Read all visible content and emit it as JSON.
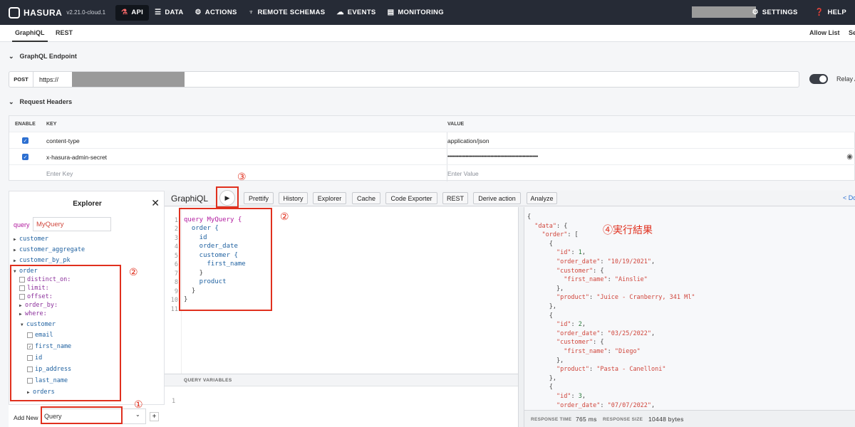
{
  "topnav": {
    "logo": "HASURA",
    "version": "v2.21.0-cloud.1",
    "items": [
      {
        "label": "API",
        "icon": "flask-icon"
      },
      {
        "label": "DATA",
        "icon": "database-icon"
      },
      {
        "label": "ACTIONS",
        "icon": "gear-icon"
      },
      {
        "label": "REMOTE SCHEMAS",
        "icon": "plug-icon"
      },
      {
        "label": "EVENTS",
        "icon": "cloud-icon"
      },
      {
        "label": "MONITORING",
        "icon": "chart-icon"
      }
    ],
    "settings": "SETTINGS",
    "help": "HELP"
  },
  "subtabs": {
    "graphiql": "GraphiQL",
    "rest": "REST",
    "allow_list": "Allow List",
    "cut": "Se"
  },
  "endpoint": {
    "section": "GraphQL Endpoint",
    "method": "POST",
    "url": "https://",
    "relay": "Relay A"
  },
  "headers": {
    "section": "Request Headers",
    "columns": [
      "ENABLE",
      "KEY",
      "VALUE"
    ],
    "rows": [
      {
        "key": "content-type",
        "value": "application/json"
      },
      {
        "key": "x-hasura-admin-secret",
        "value": "•••••••••••••••••••••••••••••••••••••••••••••••••••••••••••••••••"
      }
    ],
    "key_placeholder": "Enter Key",
    "value_placeholder": "Enter Value"
  },
  "explorer": {
    "title": "Explorer",
    "query_kw": "query",
    "query_name": "MyQuery",
    "tree": [
      "customer",
      "customer_aggregate",
      "customer_by_pk",
      "order",
      "distinct_on:",
      "limit:",
      "offset:",
      "order_by:",
      "where:",
      "customer",
      "email",
      "first_name",
      "id",
      "ip_address",
      "last_name",
      "orders"
    ],
    "add_new": "Add New",
    "add_type": "Query"
  },
  "graphiql": {
    "title": "GraphiQL",
    "buttons": [
      "Prettify",
      "History",
      "Explorer",
      "Cache",
      "Code Exporter",
      "REST",
      "Derive action",
      "Analyze"
    ],
    "docs": "< Docs",
    "code": [
      "query MyQuery {",
      "  order {",
      "    id",
      "    order_date",
      "    customer {",
      "      first_name",
      "    }",
      "    product",
      "  }",
      "}",
      ""
    ],
    "query_variables": "QUERY VARIABLES",
    "qv_line": "1"
  },
  "result": {
    "lines": [
      "{",
      "  \"data\": {",
      "    \"order\": [",
      "      {",
      "        \"id\": 1,",
      "        \"order_date\": \"10/19/2021\",",
      "        \"customer\": {",
      "          \"first_name\": \"Ainslie\"",
      "        },",
      "        \"product\": \"Juice - Cranberry, 341 Ml\"",
      "      },",
      "      {",
      "        \"id\": 2,",
      "        \"order_date\": \"03/25/2022\",",
      "        \"customer\": {",
      "          \"first_name\": \"Diego\"",
      "        },",
      "        \"product\": \"Pasta - Canelloni\"",
      "      },",
      "      {",
      "        \"id\": 3,",
      "        \"order_date\": \"07/07/2022\","
    ],
    "response_time_label": "RESPONSE TIME",
    "response_time": "765 ms",
    "response_size_label": "RESPONSE SIZE",
    "response_size": "10448 bytes"
  },
  "annotations": {
    "n1": "①",
    "n2": "②",
    "n3": "③",
    "n4": "④実行結果"
  }
}
